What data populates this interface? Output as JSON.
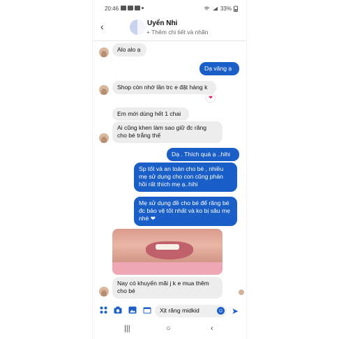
{
  "status_bar": {
    "time": "20:46",
    "battery": "33%"
  },
  "header": {
    "contact_name": "Uyển Nhi",
    "subtitle": "+ Thêm chi tiết và nhãn"
  },
  "messages": [
    {
      "side": "in",
      "text": "Alo alo ạ"
    },
    {
      "side": "out",
      "text": "Dạ vâng ạ"
    },
    {
      "side": "in",
      "text": "Shop còn nhớ lần trc e đặt hàng k",
      "reaction": "❤"
    },
    {
      "side": "in",
      "text": "Em mới dùng hết 1 chai"
    },
    {
      "side": "in",
      "text": "Ai cũng khen làm sao giữ đc răng cho bé trắng thế"
    },
    {
      "side": "out",
      "text": "Dạ . Thích quá ạ ..hihi"
    },
    {
      "side": "out",
      "text": "Sp tốt và an toàn cho bé , nhiều mẹ sử dụng cho con cũng phản hồi rất thích mẹ ạ..hihi"
    },
    {
      "side": "out",
      "text": "Mẹ sử dụng đề cho bé để răng bé đc bảo vệ tốt nhất và ko bị sâu mẹ nhé ❤"
    },
    {
      "side": "in",
      "text": "Nay có khuyến mãi j k e mua thêm cho bé"
    }
  ],
  "composer": {
    "input_value": "Xịt răng midkid"
  },
  "colors": {
    "accent": "#1a5fc8",
    "incoming_bubble": "#ededed"
  },
  "icons": {
    "back": "back-arrow-icon",
    "send": "send-icon",
    "emoji": "emoji-icon"
  }
}
